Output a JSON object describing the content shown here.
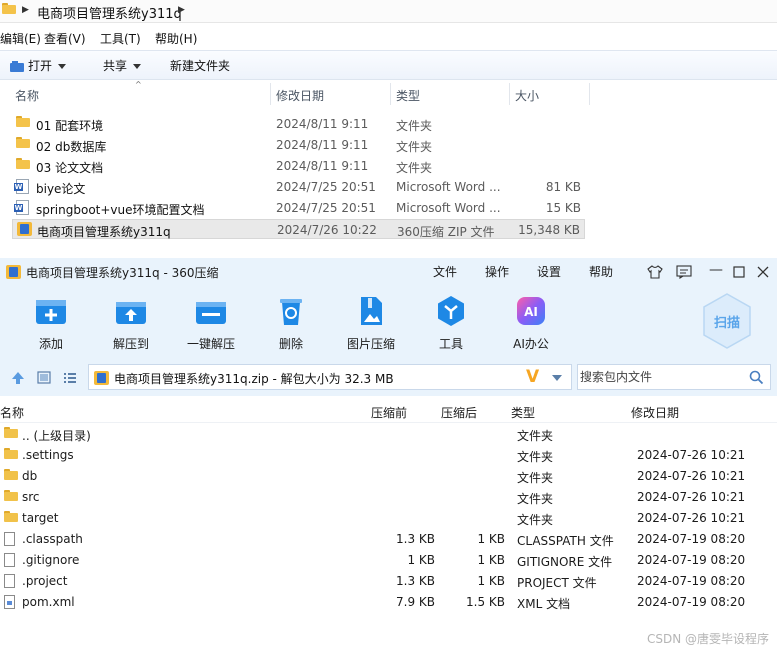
{
  "explorer": {
    "address_path": "电商项目管理系统y311q",
    "menu": [
      "编辑(E)",
      "查看(V)",
      "工具(T)",
      "帮助(H)"
    ],
    "toolbar": {
      "open": "打开",
      "share": "共享",
      "new_folder": "新建文件夹"
    },
    "columns": {
      "name": "名称",
      "date": "修改日期",
      "type": "类型",
      "size": "大小"
    },
    "rows": [
      {
        "name": "01 配套环境",
        "date": "2024/8/11 9:11",
        "type": "文件夹",
        "size": "",
        "icon": "folder-icon"
      },
      {
        "name": "02 db数据库",
        "date": "2024/8/11 9:11",
        "type": "文件夹",
        "size": "",
        "icon": "folder-icon"
      },
      {
        "name": "03 论文文档",
        "date": "2024/8/11 9:11",
        "type": "文件夹",
        "size": "",
        "icon": "folder-icon"
      },
      {
        "name": "biye论文",
        "date": "2024/7/25 20:51",
        "type": "Microsoft Word ...",
        "size": "81 KB",
        "icon": "word-doc-icon"
      },
      {
        "name": "springboot+vue环境配置文档",
        "date": "2024/7/25 20:51",
        "type": "Microsoft Word ...",
        "size": "15 KB",
        "icon": "word-doc-icon"
      },
      {
        "name": "电商项目管理系统y311q",
        "date": "2024/7/26 10:22",
        "type": "360压缩 ZIP 文件",
        "size": "15,348 KB",
        "icon": "zip-archive-icon"
      }
    ]
  },
  "zip": {
    "title": "电商项目管理系统y311q - 360压缩",
    "menu": [
      "文件",
      "操作",
      "设置",
      "帮助"
    ],
    "tools": [
      "添加",
      "解压到",
      "一键解压",
      "删除",
      "图片压缩",
      "工具",
      "AI办公"
    ],
    "scan": "扫描",
    "ai_badge": "AI",
    "path_text": "电商项目管理系统y311q.zip - 解包大小为 32.3 MB",
    "search_placeholder": "搜索包内文件",
    "columns": {
      "name": "名称",
      "compressed": "压缩前",
      "packed": "压缩后",
      "type": "类型",
      "date": "修改日期"
    },
    "rows": [
      {
        "name": ".. (上级目录)",
        "compressed": "",
        "packed": "",
        "type": "文件夹",
        "date": "",
        "icon": "folder-icon"
      },
      {
        "name": ".settings",
        "compressed": "",
        "packed": "",
        "type": "文件夹",
        "date": "2024-07-26 10:21",
        "icon": "folder-icon"
      },
      {
        "name": "db",
        "compressed": "",
        "packed": "",
        "type": "文件夹",
        "date": "2024-07-26 10:21",
        "icon": "folder-icon"
      },
      {
        "name": "src",
        "compressed": "",
        "packed": "",
        "type": "文件夹",
        "date": "2024-07-26 10:21",
        "icon": "folder-icon"
      },
      {
        "name": "target",
        "compressed": "",
        "packed": "",
        "type": "文件夹",
        "date": "2024-07-26 10:21",
        "icon": "folder-icon"
      },
      {
        "name": ".classpath",
        "compressed": "1.3 KB",
        "packed": "1 KB",
        "type": "CLASSPATH 文件",
        "date": "2024-07-19 08:20",
        "icon": "file-icon"
      },
      {
        "name": ".gitignore",
        "compressed": "1 KB",
        "packed": "1 KB",
        "type": "GITIGNORE 文件",
        "date": "2024-07-19 08:20",
        "icon": "file-icon"
      },
      {
        "name": ".project",
        "compressed": "1.3 KB",
        "packed": "1 KB",
        "type": "PROJECT 文件",
        "date": "2024-07-19 08:20",
        "icon": "file-icon"
      },
      {
        "name": "pom.xml",
        "compressed": "7.9 KB",
        "packed": "1.5 KB",
        "type": "XML 文档",
        "date": "2024-07-19 08:20",
        "icon": "xml-file-icon"
      }
    ]
  },
  "watermark": "CSDN @唐雯毕设程序",
  "colors": {
    "accent_blue": "#1e88e5",
    "toolbar_bg": "#e9f3fc",
    "folder_yellow": "#f4c34a",
    "selection": "#e9e9e9"
  }
}
